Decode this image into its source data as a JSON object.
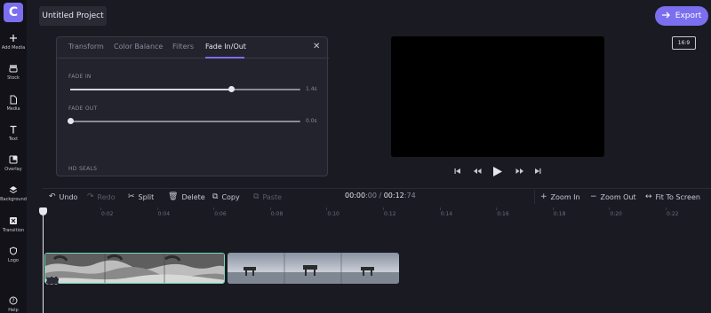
{
  "app": {
    "logo_letter": "C",
    "brand_color": "#7b6ff0"
  },
  "sidebar": {
    "items": [
      {
        "label": "Add Media",
        "icon": "plus-icon"
      },
      {
        "label": "Stock",
        "icon": "stock-icon"
      },
      {
        "label": "Media",
        "icon": "file-icon"
      },
      {
        "label": "Text",
        "icon": "text-icon"
      },
      {
        "label": "Overlay",
        "icon": "overlay-icon"
      },
      {
        "label": "Background",
        "icon": "layers-icon"
      },
      {
        "label": "Transition",
        "icon": "transition-icon"
      },
      {
        "label": "Logo",
        "icon": "shield-icon"
      },
      {
        "label": "Help",
        "icon": "help-icon"
      }
    ]
  },
  "header": {
    "project_title": "Untitled Project",
    "export_label": "Export"
  },
  "panel": {
    "tabs": [
      "Transform",
      "Color Balance",
      "Filters",
      "Fade In/Out"
    ],
    "active_tab": "Fade In/Out",
    "fade_in": {
      "label": "FADE IN",
      "value_text": "1.4s",
      "value": 0.7
    },
    "fade_out": {
      "label": "FADE OUT",
      "value_text": "0.0s",
      "value": 0.0
    },
    "footer_label": "HD SEALS"
  },
  "preview": {
    "aspect_ratio": "16:9"
  },
  "toolbar": {
    "undo": "Undo",
    "redo": "Redo",
    "split": "Split",
    "delete": "Delete",
    "copy": "Copy",
    "paste": "Paste",
    "zoom_in": "Zoom In",
    "zoom_out": "Zoom Out",
    "fit": "Fit To Screen"
  },
  "timecode": {
    "current_main": "00:00",
    "current_frac": ":00",
    "separator": " / ",
    "total_main": "00:12",
    "total_frac": ":74"
  },
  "timeline": {
    "ticks": [
      "0:02",
      "0:04",
      "0:06",
      "0:08",
      "0:10",
      "0:12",
      "0:14",
      "0:16",
      "0:18",
      "0:20",
      "0:22"
    ]
  }
}
